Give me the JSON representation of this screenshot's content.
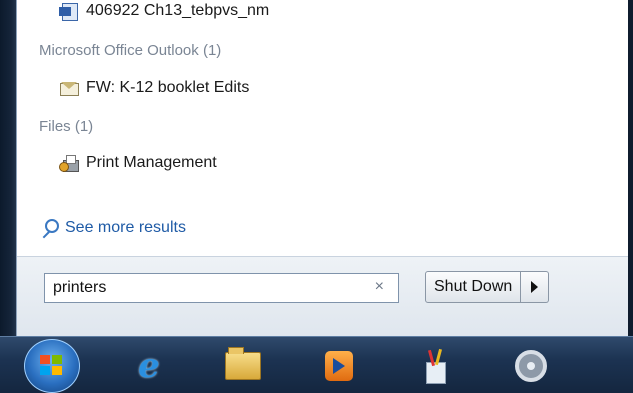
{
  "results": {
    "top_item": {
      "label": "406922 Ch13_tebpvs_nm",
      "icon": "word-document-icon"
    },
    "groups": [
      {
        "heading": "Microsoft Office Outlook (1)",
        "items": [
          {
            "label": "FW: K-12 booklet Edits",
            "icon": "email-envelope-icon"
          }
        ]
      },
      {
        "heading": "Files (1)",
        "items": [
          {
            "label": "Print Management",
            "icon": "print-management-icon"
          }
        ]
      }
    ],
    "see_more": "See more results"
  },
  "search": {
    "value": "printers",
    "clear_glyph": "×"
  },
  "power": {
    "shutdown_label": "Shut Down"
  },
  "taskbar": {
    "buttons": [
      "start-orb",
      "internet-explorer",
      "windows-explorer",
      "media-player",
      "tools",
      "sync"
    ]
  },
  "colors": {
    "link": "#1f5ba6",
    "group_heading": "#7a8594",
    "taskbar": "#1c3352"
  }
}
